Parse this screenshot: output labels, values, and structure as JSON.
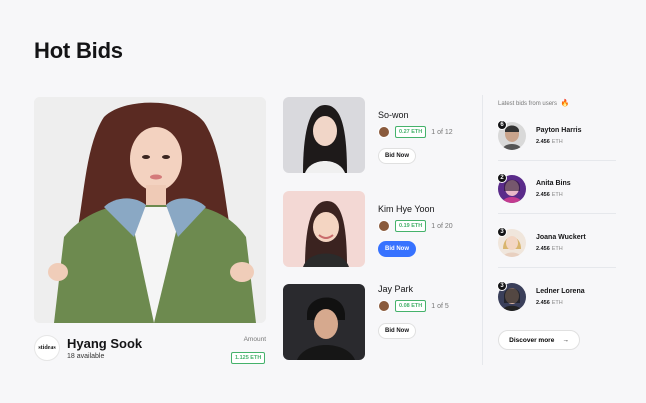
{
  "page": {
    "title": "Hot Bids"
  },
  "featured": {
    "logo_text": "stideas",
    "name": "Hyang Sook",
    "available": "18 available",
    "amount_label": "Amount",
    "price": "1.125 ETH"
  },
  "bids": [
    {
      "name": "So-won",
      "price": "0.27 ETH",
      "stock": "1 of 12",
      "button": "Bid Now",
      "active": false
    },
    {
      "name": "Kim Hye Yoon",
      "price": "0.19 ETH",
      "stock": "1 of 20",
      "button": "Bid Now",
      "active": true
    },
    {
      "name": "Jay Park",
      "price": "0.08 ETH",
      "stock": "1 of 5",
      "button": "Bid Now",
      "active": false
    }
  ],
  "latest": {
    "title": "Latest bids from users",
    "icon": "fire-icon",
    "users": [
      {
        "rank": "6",
        "name": "Payton Harris",
        "amount": "2.456",
        "unit": "ETH"
      },
      {
        "rank": "2",
        "name": "Anita Bins",
        "amount": "2.456",
        "unit": "ETH"
      },
      {
        "rank": "3",
        "name": "Joana Wuckert",
        "amount": "2.456",
        "unit": "ETH"
      },
      {
        "rank": "3",
        "name": "Ledner Lorena",
        "amount": "2.456",
        "unit": "ETH"
      }
    ],
    "discover_label": "Discover more",
    "discover_icon": "arrow-right-icon"
  },
  "colors": {
    "accent": "#3772ff",
    "eth_green": "#45b26b",
    "background": "#f7f7f9"
  }
}
